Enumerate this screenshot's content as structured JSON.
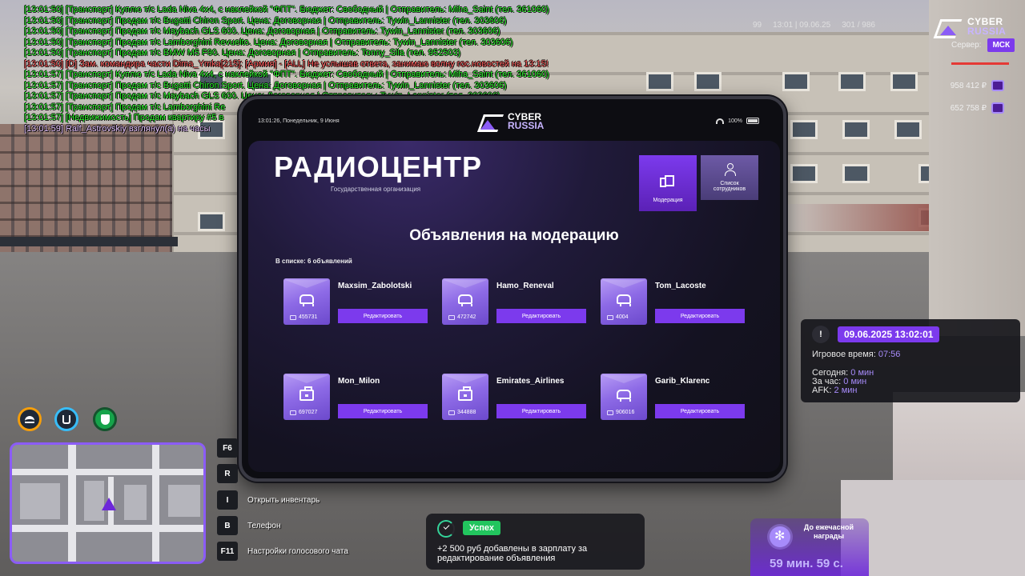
{
  "chat": [
    {
      "text": "[13:01:50] [Транспорт] Куплю т/с Lada Niva 4x4, с наклейкой \"ФПТ\". Бюджет: Свободный | Отправитель: Miha_Saint (тел. 361060)",
      "color": "green"
    },
    {
      "text": "[13:01:50] [Транспорт] Продам т/с Bugatti Chiron Sport. Цена: Договорная | Отправитель: Tywin_Lannister (тел. 303606)",
      "color": "green"
    },
    {
      "text": "[13:01:50] [Транспорт] Продам т/с Maybach GLS 600. Цена: Договорная | Отправитель: Tywin_Lannister (тел. 303606)",
      "color": "green"
    },
    {
      "text": "[13:01:50] [Транспорт] Продам т/с Lamborghini Revuelto. Цена: Договорная | Отправитель: Tywin_Lannister (тел. 303606)",
      "color": "green"
    },
    {
      "text": "[13:01:50] [Транспорт] Продам т/с BMW M5 F90. Цена: Договорная | Отправитель: Tonny_Sila (тел. 952503)",
      "color": "green"
    },
    {
      "text": "[13:01:50] [D] Зам. командира части Dima_Ymka[215]: [Армия] - [ALL] Не услышав ответа, занимаю волну гос.новостей на 13:15!",
      "color": "red"
    },
    {
      "text": "[13:01:57] [Транспорт] Куплю т/с Lada Niva 4x4, с наклейкой \"ФПТ\". Бюджет: Свободный | Отправитель: Miha_Saint (тел. 361060)",
      "color": "green"
    },
    {
      "text": "[13:01:57] [Транспорт] Продам т/с Bugatti Chiron Sport. Цена: Договорная | Отправитель: Tywin_Lannister (тел. 303606)",
      "color": "green"
    },
    {
      "text": "[13:01:57] [Транспорт] Продам т/с Maybach GLS 600. Цена: Договорная | Отправитель: Tywin_Lannister (тел. 303606)",
      "color": "green"
    },
    {
      "text": "[13:01:57] [Транспорт] Продам т/с Lamborghini Re",
      "color": "green"
    },
    {
      "text": "[13:01:57] [Недвижимость] Продам квартиру #5 в",
      "color": "green"
    },
    {
      "text": "[13:01:59] Ralf_Astrovskiy взглянул(а) на часы",
      "color": "pink"
    }
  ],
  "hud_top": {
    "ping": "99",
    "time": "13:01 | 09.06.25",
    "online": "301 / 986",
    "logo_line1": "CYBER",
    "logo_line2": "RUSSIA",
    "server_label": "Сервер:",
    "server_name": "МСК",
    "cash": "958 412 ₽",
    "bank": "652 758 ₽"
  },
  "tablet": {
    "status_time": "13:01:26, Понедельник, 9 Июня",
    "battery": "100%",
    "logo_line1": "CYBER",
    "logo_line2": "RUSSIA",
    "org_title": "РАДИОЦЕНТР",
    "org_subtitle": "Государственная организация",
    "nav": {
      "moderation": "Модерация",
      "staff": "Список сотрудников"
    },
    "section_title": "Объявления на модерацию",
    "count_label": "В списке: 6 объявлений",
    "edit_label": "Редактировать",
    "ads": [
      {
        "name": "Maxsim_Zabolotski",
        "id": "455731",
        "icon": "car-icon"
      },
      {
        "name": "Hamo_Reneval",
        "id": "472742",
        "icon": "car-icon"
      },
      {
        "name": "Tom_Lacoste",
        "id": "4004",
        "icon": "car-icon"
      },
      {
        "name": "Mon_Milon",
        "id": "697027",
        "icon": "briefcase-icon"
      },
      {
        "name": "Emirates_Airlines",
        "id": "344888",
        "icon": "briefcase-icon"
      },
      {
        "name": "Garib_Klarenc",
        "id": "906016",
        "icon": "car-icon"
      }
    ]
  },
  "keys": [
    {
      "key": "F6",
      "label": ""
    },
    {
      "key": "R",
      "label": ""
    },
    {
      "key": "I",
      "label": "Открыть инвентарь"
    },
    {
      "key": "B",
      "label": "Телефон"
    },
    {
      "key": "F11",
      "label": "Настройки голосового чата"
    }
  ],
  "toast": {
    "badge": "Успех",
    "text": "+2 500 руб добавлены в зарплату за редактирование объявления"
  },
  "info": {
    "date": "09.06.2025 13:02:01",
    "game_time_label": "Игровое время:",
    "game_time": "07:56",
    "today_label": "Сегодня:",
    "today": "0 мин",
    "hour_label": "За час:",
    "hour": "0 мин",
    "afk_label": "AFK:",
    "afk": "2 мин"
  },
  "reward": {
    "title": "До ежечасной награды",
    "timer": "59 мин. 59 с."
  },
  "colors": {
    "accent": "#7c3aed",
    "success": "#22c55e",
    "chat_green": "#2df52d",
    "chat_red": "#ff5c5c"
  }
}
